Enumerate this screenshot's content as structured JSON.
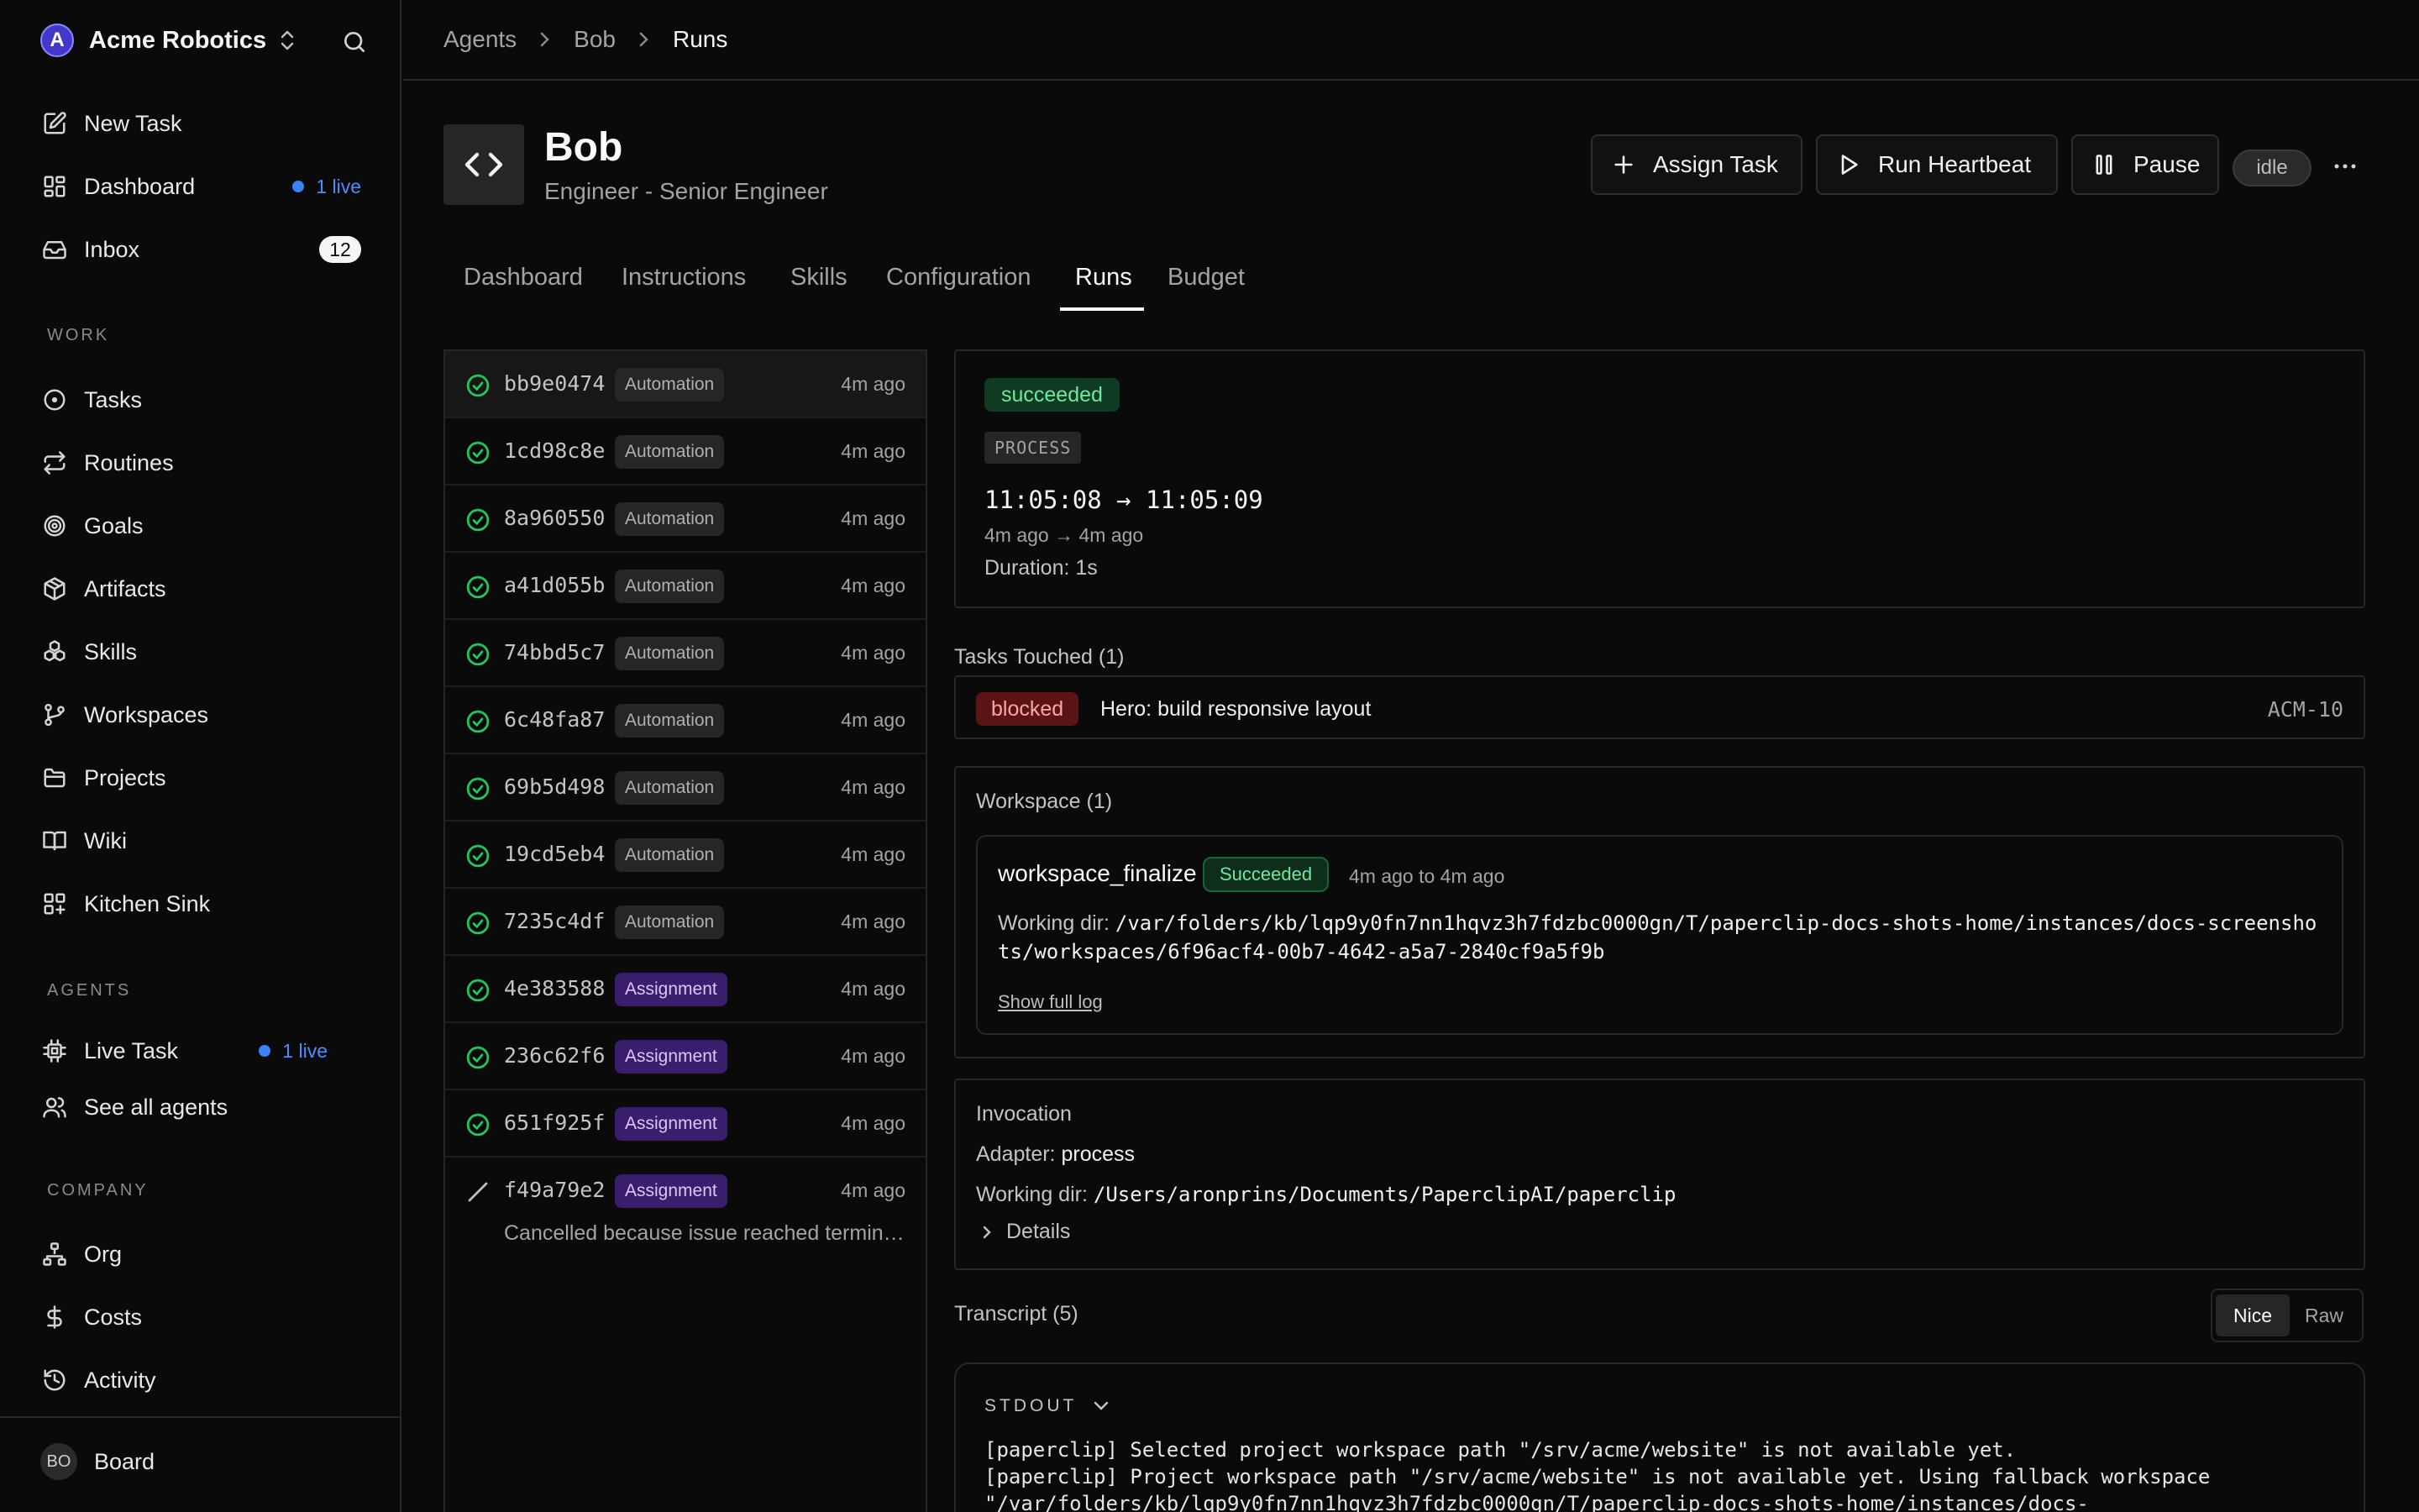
{
  "sidebar": {
    "brand": {
      "name": "Acme Robotics",
      "logo_letter": "A"
    },
    "nav": [
      {
        "label": "New Task",
        "icon": "edit-icon"
      },
      {
        "label": "Dashboard",
        "icon": "dashboard-icon",
        "live": "1 live"
      },
      {
        "label": "Inbox",
        "icon": "inbox-icon",
        "badge": "12"
      }
    ],
    "sections": {
      "work": "WORK",
      "agents": "AGENTS",
      "company": "COMPANY"
    },
    "work_items": [
      {
        "label": "Tasks",
        "icon": "circle-dot-icon"
      },
      {
        "label": "Routines",
        "icon": "repeat-icon"
      },
      {
        "label": "Goals",
        "icon": "target-icon"
      },
      {
        "label": "Artifacts",
        "icon": "box-icon"
      },
      {
        "label": "Skills",
        "icon": "boxes-icon"
      },
      {
        "label": "Workspaces",
        "icon": "git-branch-icon"
      },
      {
        "label": "Projects",
        "icon": "folder-icon"
      },
      {
        "label": "Wiki",
        "icon": "book-icon"
      },
      {
        "label": "Kitchen Sink",
        "icon": "grid-plus-icon"
      }
    ],
    "agent_items": [
      {
        "label": "Live Task",
        "icon": "cpu-icon",
        "live": "1 live"
      },
      {
        "label": "See all agents",
        "icon": "users-icon"
      }
    ],
    "company_items": [
      {
        "label": "Org",
        "icon": "org-chart-icon"
      },
      {
        "label": "Costs",
        "icon": "dollar-icon"
      },
      {
        "label": "Activity",
        "icon": "history-icon"
      }
    ],
    "user": {
      "initials": "BO",
      "label": "Board"
    }
  },
  "breadcrumb": [
    "Agents",
    "Bob",
    "Runs"
  ],
  "agent": {
    "name": "Bob",
    "role": "Engineer - Senior Engineer",
    "status": "idle"
  },
  "actions": {
    "assign": "Assign Task",
    "heartbeat": "Run Heartbeat",
    "pause": "Pause"
  },
  "tabs": [
    "Dashboard",
    "Instructions",
    "Skills",
    "Configuration",
    "Runs",
    "Budget"
  ],
  "runs": [
    {
      "id": "bb9e0474",
      "kind": "Automation",
      "ago": "4m ago",
      "status": "succeeded"
    },
    {
      "id": "1cd98c8e",
      "kind": "Automation",
      "ago": "4m ago",
      "status": "succeeded"
    },
    {
      "id": "8a960550",
      "kind": "Automation",
      "ago": "4m ago",
      "status": "succeeded"
    },
    {
      "id": "a41d055b",
      "kind": "Automation",
      "ago": "4m ago",
      "status": "succeeded"
    },
    {
      "id": "74bbd5c7",
      "kind": "Automation",
      "ago": "4m ago",
      "status": "succeeded"
    },
    {
      "id": "6c48fa87",
      "kind": "Automation",
      "ago": "4m ago",
      "status": "succeeded"
    },
    {
      "id": "69b5d498",
      "kind": "Automation",
      "ago": "4m ago",
      "status": "succeeded"
    },
    {
      "id": "19cd5eb4",
      "kind": "Automation",
      "ago": "4m ago",
      "status": "succeeded"
    },
    {
      "id": "7235c4df",
      "kind": "Automation",
      "ago": "4m ago",
      "status": "succeeded"
    },
    {
      "id": "4e383588",
      "kind": "Assignment",
      "ago": "4m ago",
      "status": "succeeded"
    },
    {
      "id": "236c62f6",
      "kind": "Assignment",
      "ago": "4m ago",
      "status": "succeeded"
    },
    {
      "id": "651f925f",
      "kind": "Assignment",
      "ago": "4m ago",
      "status": "succeeded"
    },
    {
      "id": "f49a79e2",
      "kind": "Assignment",
      "ago": "4m ago",
      "status": "cancelled",
      "note": "Cancelled because issue reached terminal status"
    }
  ],
  "detail": {
    "status": "succeeded",
    "adapter_badge": "PROCESS",
    "time_range": "11:05:08 → 11:05:09",
    "ago_range": "4m ago → 4m ago",
    "duration": "Duration: 1s",
    "tasks_title": "Tasks Touched (1)",
    "task": {
      "status": "blocked",
      "title": "Hero: build responsive layout",
      "id": "ACM-10"
    },
    "workspace_title": "Workspace (1)",
    "workspace": {
      "name": "workspace_finalize",
      "status": "Succeeded",
      "time": "4m ago to 4m ago",
      "dir_label": "Working dir:",
      "dir": "/var/folders/kb/lqp9y0fn7nn1hqvz3h7fdzbc0000gn/T/paperclip-docs-shots-home/instances/docs-screenshots/workspaces/6f96acf4-00b7-4642-a5a7-2840cf9a5f9b",
      "log_link": "Show full log"
    },
    "invocation": {
      "title": "Invocation",
      "adapter_label": "Adapter:",
      "adapter": "process",
      "dir_label": "Working dir:",
      "dir": "/Users/aronprins/Documents/PaperclipAI/paperclip",
      "details": "Details"
    },
    "transcript": {
      "title": "Transcript (5)",
      "modes": [
        "Nice",
        "Raw"
      ],
      "stream": "STDOUT",
      "lines": [
        "[paperclip] Selected project workspace path \"/srv/acme/website\" is not available yet.",
        "[paperclip] Project workspace path \"/srv/acme/website\" is not available yet. Using fallback workspace",
        "\"/var/folders/kb/lqp9y0fn7nn1hqvz3h7fdzbc0000gn/T/paperclip-docs-shots-home/instances/docs-"
      ]
    }
  },
  "colors": {
    "background": "#0a0a0a",
    "success": "#22c55e",
    "live": "#3b82f6",
    "blocked": "#5a1414",
    "assignment": "#3b1d6e"
  }
}
